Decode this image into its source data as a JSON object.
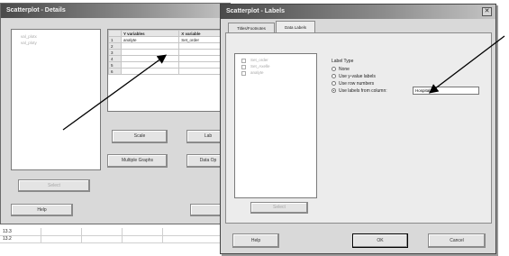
{
  "back_dialog": {
    "title": "Scatterplot - Details",
    "list_items": [
      "val_plotx",
      "val_ploty"
    ],
    "grid_headers": [
      "Y variables",
      "X variable"
    ],
    "grid_rows": [
      {
        "num": "1",
        "y": "analyte",
        "x": "Set_order"
      },
      {
        "num": "2",
        "y": "",
        "x": ""
      },
      {
        "num": "3",
        "y": "",
        "x": ""
      },
      {
        "num": "4",
        "y": "",
        "x": ""
      },
      {
        "num": "5",
        "y": "",
        "x": ""
      },
      {
        "num": "6",
        "y": "",
        "x": ""
      }
    ],
    "scales_label": "Scale",
    "labels_label": "Lab",
    "multiple_graphs_label": "Multiple Graphs",
    "data_options_label": "Data Op",
    "select_label": "Select",
    "help_label": "Help",
    "ok_label": "O"
  },
  "sheet_values": [
    "13.3",
    "13.2"
  ],
  "front_dialog": {
    "title": "Scatterplot - Labels",
    "close_glyph": "✕",
    "tabs": [
      "Titles/Footnotes",
      "Data Labels"
    ],
    "list_items": [
      "Set_order",
      "Set_Axelle",
      "analyte"
    ],
    "label_type_heading": "Label Type",
    "options": [
      {
        "label": "None",
        "selected": false
      },
      {
        "label": "Use y-value labels",
        "selected": false
      },
      {
        "label": "Use row numbers",
        "selected": false
      },
      {
        "label": "Use labels from column:",
        "selected": true
      }
    ],
    "column_value": "Hospitals",
    "select_label": "Select",
    "help_label": "Help",
    "ok_label": "OK",
    "cancel_label": "Cancel"
  }
}
